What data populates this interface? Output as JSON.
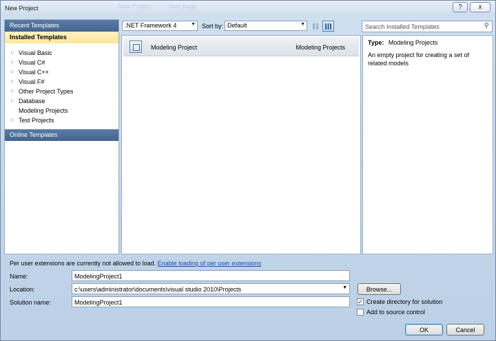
{
  "window": {
    "title": "New Project",
    "ghost_text_1": "New Project",
    "ghost_text_2": "Start page",
    "help_label": "?",
    "close_label": "x"
  },
  "left": {
    "recent_templates": "Recent Templates",
    "installed_templates": "Installed Templates",
    "online_templates": "Online Templates",
    "tree": [
      {
        "label": "Visual Basic",
        "expandable": true
      },
      {
        "label": "Visual C#",
        "expandable": true
      },
      {
        "label": "Visual C++",
        "expandable": true
      },
      {
        "label": "Visual F#",
        "expandable": true
      },
      {
        "label": "Other Project Types",
        "expandable": true
      },
      {
        "label": "Database",
        "expandable": true
      },
      {
        "label": "Modeling Projects",
        "expandable": false
      },
      {
        "label": "Test Projects",
        "expandable": true
      }
    ]
  },
  "toolbar": {
    "framework": ".NET Framework 4",
    "sort_by_label": "Sort by:",
    "sort_value": "Default",
    "search_placeholder": "Search Installed Templates"
  },
  "templates": [
    {
      "name": "Modeling Project",
      "type": "Modeling Projects"
    }
  ],
  "details": {
    "type_label": "Type:",
    "type_value": "Modeling Projects",
    "description": "An empty project for creating a set of related models"
  },
  "footer": {
    "notice": "Per user extensions are currently not allowed to load.",
    "notice_link": "Enable loading of per user extensions",
    "name_label": "Name:",
    "name_value": "ModelingProject1",
    "location_label": "Location:",
    "location_value": "c:\\users\\administrator\\documents\\visual studio 2010\\Projects",
    "solution_label": "Solution name:",
    "solution_value": "ModelingProject1",
    "browse_label": "Browse...",
    "create_dir_label": "Create directory for solution",
    "create_dir_checked": true,
    "source_control_label": "Add to source control",
    "source_control_checked": false,
    "ok_label": "OK",
    "cancel_label": "Cancel"
  },
  "colors": {
    "selected_header": "#fde59a",
    "header_blue": "#4a6c97",
    "link": "#1a4fa8"
  }
}
